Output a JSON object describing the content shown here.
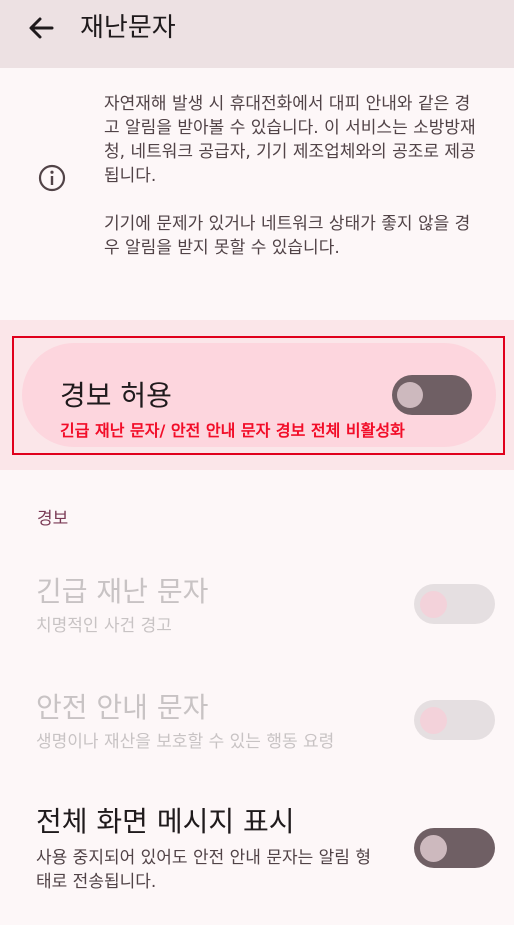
{
  "header": {
    "title": "재난문자"
  },
  "info": {
    "paragraph1": "자연재해 발생 시 휴대전화에서 대피 안내와 같은 경고 알림을 받아볼 수 있습니다. 이 서비스는 소방방재청, 네트워크 공급자, 기기 제조업체와의 공조로 제공됩니다.",
    "paragraph2": "기기에 문제가 있거나 네트워크 상태가 좋지 않을 경우 알림을 받지 못할 수 있습니다."
  },
  "allow_alerts": {
    "title": "경보 허용",
    "annotation": "긴급 재난 문자/ 안전 안내 문자 경보 전체 비활성화",
    "enabled": false
  },
  "section": {
    "label": "경보"
  },
  "items": [
    {
      "title": "긴급 재난 문자",
      "subtitle": "치명적인 사건 경고",
      "enabled": false,
      "disabled": true
    },
    {
      "title": "안전 안내 문자",
      "subtitle": "생명이나 재산을 보호할 수 있는 행동 요령",
      "enabled": false,
      "disabled": true
    },
    {
      "title": "전체 화면 메시지 표시",
      "subtitle": "사용 중지되어 있어도 안전 안내 문자는 알림 형태로 전송됩니다.",
      "enabled": false,
      "disabled": false
    }
  ],
  "colors": {
    "header_bg": "#ede1e3",
    "highlight_pill": "#fdd6de",
    "annotation_red": "#f20d28",
    "section_label": "#7a3a55"
  }
}
